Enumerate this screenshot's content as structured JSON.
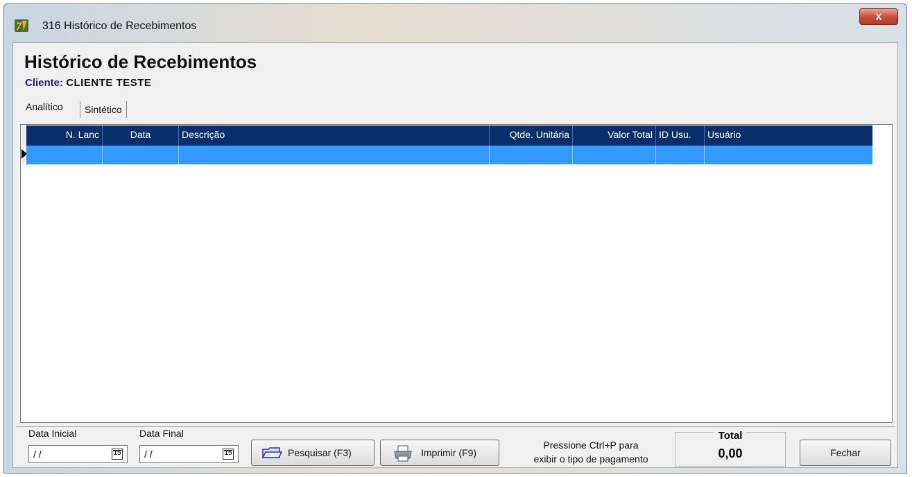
{
  "window": {
    "title": "316 Histórico de Recebimentos",
    "close_label": "X"
  },
  "heading": "Histórico de Recebimentos",
  "client": {
    "label": "Cliente:",
    "value": "CLIENTE TESTE"
  },
  "tabs": [
    {
      "label": "Analítico"
    },
    {
      "label": "Sintético"
    }
  ],
  "grid": {
    "columns": [
      {
        "label": "N. Lanc"
      },
      {
        "label": "Data"
      },
      {
        "label": "Descrição"
      },
      {
        "label": "Qtde. Unitária"
      },
      {
        "label": "Valor Total"
      },
      {
        "label": "ID Usu."
      },
      {
        "label": "Usuário"
      }
    ],
    "selected_row_color": "#3399ff",
    "header_color": "#0b2f6b"
  },
  "filters": {
    "start_label": "Data Inicial",
    "start_value": "/ /",
    "end_label": "Data Final",
    "end_value": "/ /",
    "calendar_day": "15"
  },
  "buttons": {
    "search": "Pesquisar (F3)",
    "print": "Imprimir (F9)",
    "close": "Fechar"
  },
  "info_lines": [
    "Pressione Ctrl+P para",
    "exibir o tipo de pagamento"
  ],
  "total": {
    "label": "Total",
    "value": "0,00"
  }
}
